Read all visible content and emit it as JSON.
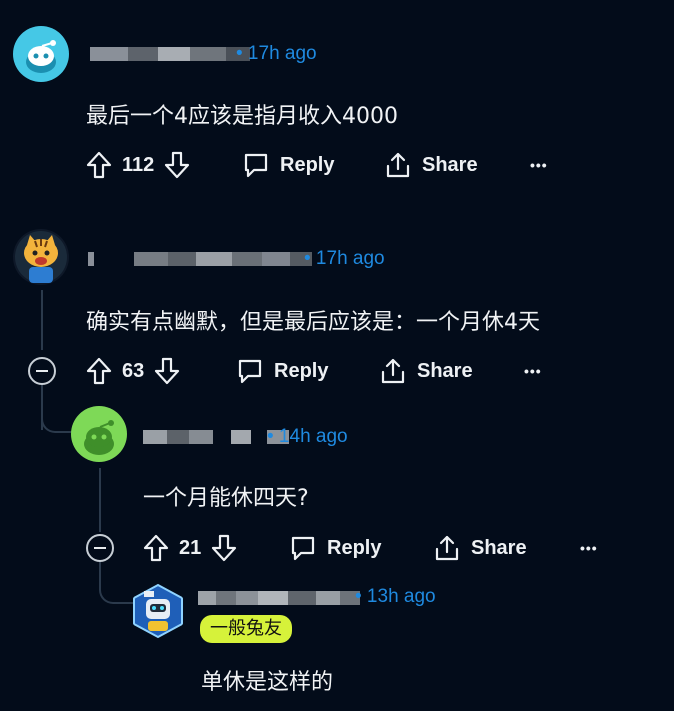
{
  "comments": [
    {
      "time": "• 17h ago",
      "text": "最后一个4应该是指月收入4000",
      "votes": "112",
      "reply_label": "Reply",
      "share_label": "Share",
      "more_label": "•••"
    },
    {
      "time": "• 17h ago",
      "text": "确实有点幽默，但是最后应该是：一个月休4天",
      "votes": "63",
      "reply_label": "Reply",
      "share_label": "Share",
      "more_label": "•••"
    },
    {
      "time": "• 14h ago",
      "text": "一个月能休四天?",
      "votes": "21",
      "reply_label": "Reply",
      "share_label": "Share",
      "more_label": "•••"
    },
    {
      "time": "• 13h ago",
      "flair": "一般兔友",
      "text": "单休是这样的"
    }
  ],
  "colors": {
    "background": "#030c1a",
    "timestamp": "#1f8ae0",
    "flair_bg": "#d6f23a",
    "thread_line": "#2b3a4c"
  },
  "icons": [
    "upvote-icon",
    "downvote-icon",
    "comment-bubble-icon",
    "share-icon",
    "collapse-icon",
    "snoo-avatar-icon"
  ]
}
